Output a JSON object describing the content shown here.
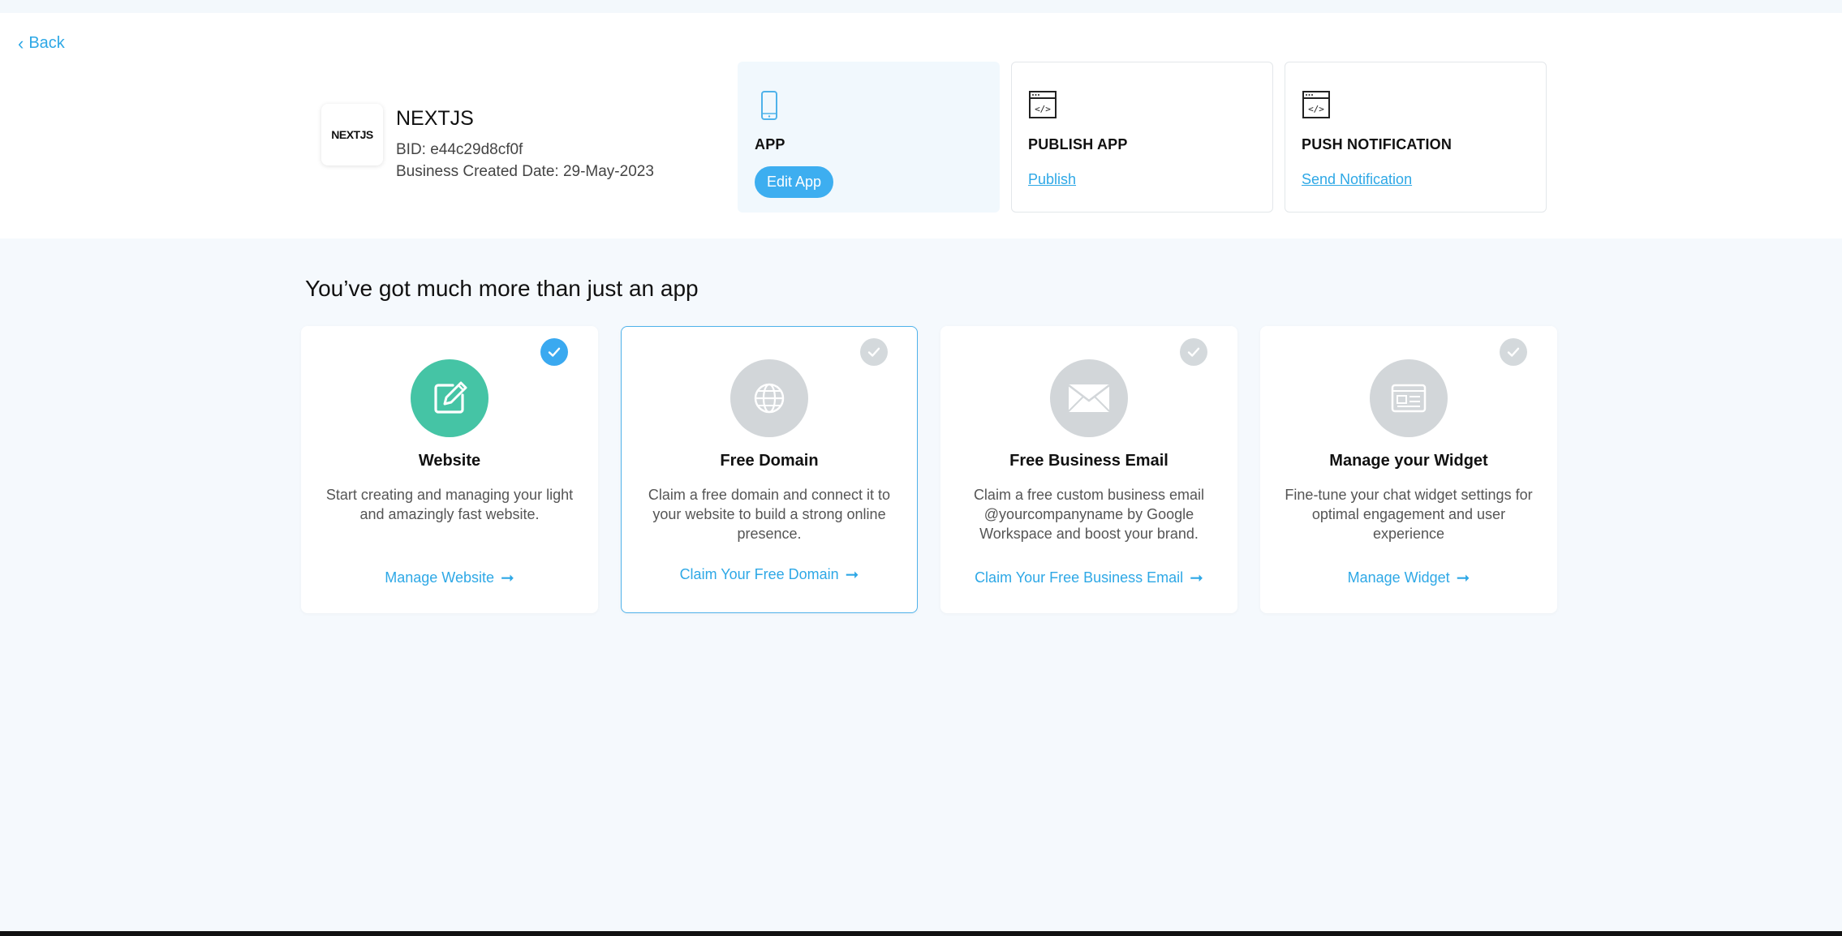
{
  "nav": {
    "back_label": "Back"
  },
  "business": {
    "logo_text": "NEXTJS",
    "name": "NEXTJS",
    "bid": "BID: e44c29d8cf0f",
    "created": "Business Created Date: 29-May-2023"
  },
  "actions": [
    {
      "title": "APP",
      "button": "Edit App",
      "icon": "phone-icon"
    },
    {
      "title": "PUBLISH APP",
      "link": "Publish",
      "icon": "code-window-icon"
    },
    {
      "title": "PUSH NOTIFICATION",
      "link": "Send Notification",
      "icon": "code-window-icon"
    }
  ],
  "section": {
    "title": "You’ve got much more than just an app"
  },
  "features": [
    {
      "title": "Website",
      "desc": "Start creating and managing your light and amazingly fast website.",
      "link": "Manage Website",
      "icon": "edit-icon",
      "checked": true
    },
    {
      "title": "Free Domain",
      "desc": "Claim a free domain and connect it to your website to build a strong online presence.",
      "link": "Claim Your Free Domain",
      "icon": "globe-icon",
      "checked": false
    },
    {
      "title": "Free Business Email",
      "desc": "Claim a free custom business email @yourcompanyname by Google Workspace and boost your brand.",
      "link": "Claim Your Free Business Email",
      "icon": "mail-icon",
      "checked": false
    },
    {
      "title": "Manage your Widget",
      "desc": "Fine-tune your chat widget settings for optimal engagement and user experience",
      "link": "Manage Widget",
      "icon": "widget-icon",
      "checked": false
    }
  ],
  "colors": {
    "accent": "#2ea8e6",
    "button": "#3daef0",
    "green": "#45c4a5",
    "check_on": "#3aa9f0",
    "check_off": "#d4d9dc"
  }
}
